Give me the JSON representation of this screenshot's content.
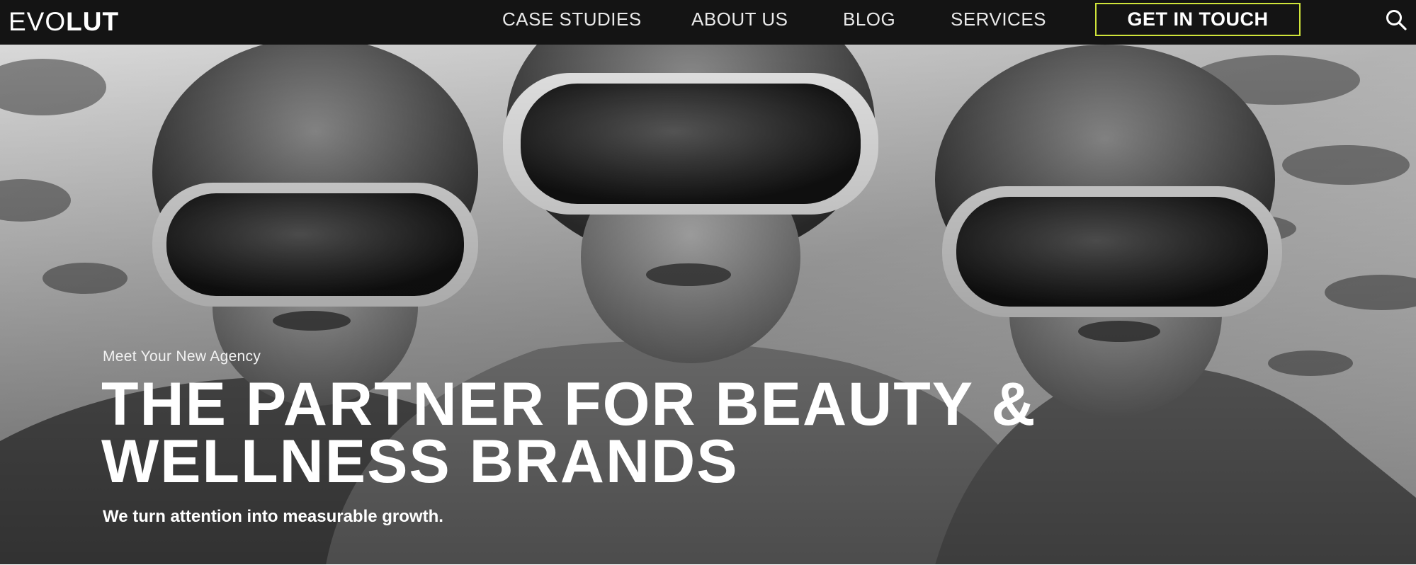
{
  "brand": {
    "logo_thin": "EVO",
    "logo_bold": "LUT"
  },
  "nav": {
    "items": [
      {
        "label": "CASE STUDIES"
      },
      {
        "label": "ABOUT US"
      },
      {
        "label": "BLOG"
      },
      {
        "label": "SERVICES"
      }
    ],
    "cta_label": "GET IN TOUCH",
    "search_icon": "search-icon"
  },
  "hero": {
    "eyebrow": "Meet Your New Agency",
    "headline_line1": "THE PARTNER FOR BEAUTY &",
    "headline_line2": "WELLNESS BRANDS",
    "tagline": "We turn attention into measurable growth.",
    "image_description": ""
  },
  "colors": {
    "nav_bg": "#141414",
    "accent": "#cfe43a",
    "text": "#ffffff"
  }
}
